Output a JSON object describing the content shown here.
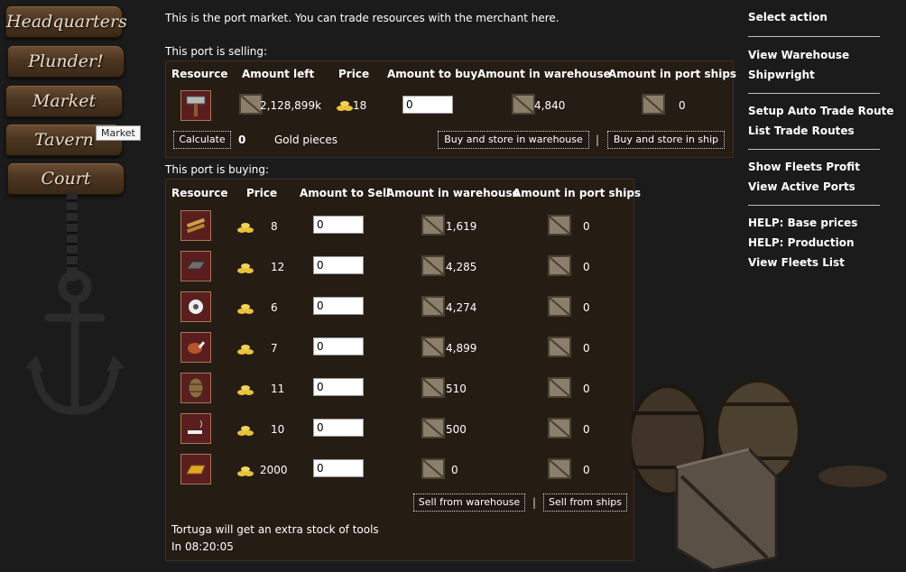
{
  "nav": {
    "items": [
      "Headquarters",
      "Plunder!",
      "Market",
      "Tavern",
      "Court"
    ],
    "tooltip": "Market"
  },
  "intro": "This is the port market. You can trade resources with the merchant here.",
  "selling": {
    "title": "This port is selling:",
    "headers": [
      "Resource",
      "Amount left",
      "Price",
      "Amount to buy",
      "Amount in warehouse",
      "Amount in port ships"
    ],
    "row": {
      "resource_icon": "tools-icon",
      "amount_left": "2,128,899k",
      "price": "18",
      "amount_to_buy": "0",
      "warehouse": "4,840",
      "port_ships": "0"
    },
    "calculate_label": "Calculate",
    "gold_value": "0",
    "gold_label": "Gold pieces",
    "buy_warehouse_label": "Buy and store in warehouse",
    "separator": "|",
    "buy_ship_label": "Buy and store in ship"
  },
  "buying": {
    "title": "This port is buying:",
    "headers": [
      "Resource",
      "Price",
      "Amount to Sell",
      "Amount in warehouse",
      "Amount in port ships"
    ],
    "rows": [
      {
        "icon": "wood-planks-icon",
        "price": "8",
        "sell": "0",
        "warehouse": "1,619",
        "ships": "0"
      },
      {
        "icon": "iron-ingot-icon",
        "price": "12",
        "sell": "0",
        "warehouse": "4,285",
        "ships": "0"
      },
      {
        "icon": "cotton-icon",
        "price": "6",
        "sell": "0",
        "warehouse": "4,274",
        "ships": "0"
      },
      {
        "icon": "meat-icon",
        "price": "7",
        "sell": "0",
        "warehouse": "4,899",
        "ships": "0"
      },
      {
        "icon": "barrel-icon",
        "price": "11",
        "sell": "0",
        "warehouse": "510",
        "ships": "0"
      },
      {
        "icon": "tobacco-icon",
        "price": "10",
        "sell": "0",
        "warehouse": "500",
        "ships": "0"
      },
      {
        "icon": "gold-bar-icon",
        "price": "2000",
        "sell": "0",
        "warehouse": "0",
        "ships": "0"
      }
    ],
    "sell_warehouse_label": "Sell from warehouse",
    "separator": "|",
    "sell_ships_label": "Sell from ships",
    "notice_line1": "Tortuga will get an extra stock of tools",
    "notice_line2": "In 08:20:05"
  },
  "actions": {
    "header": "Select action",
    "groups": [
      [
        "View Warehouse",
        "Shipwright"
      ],
      [
        "Setup Auto Trade Route",
        "List Trade Routes"
      ],
      [
        "Show Fleets Profit",
        "View Active Ports"
      ],
      [
        "HELP: Base prices",
        "HELP: Production",
        "View Fleets List"
      ]
    ]
  }
}
